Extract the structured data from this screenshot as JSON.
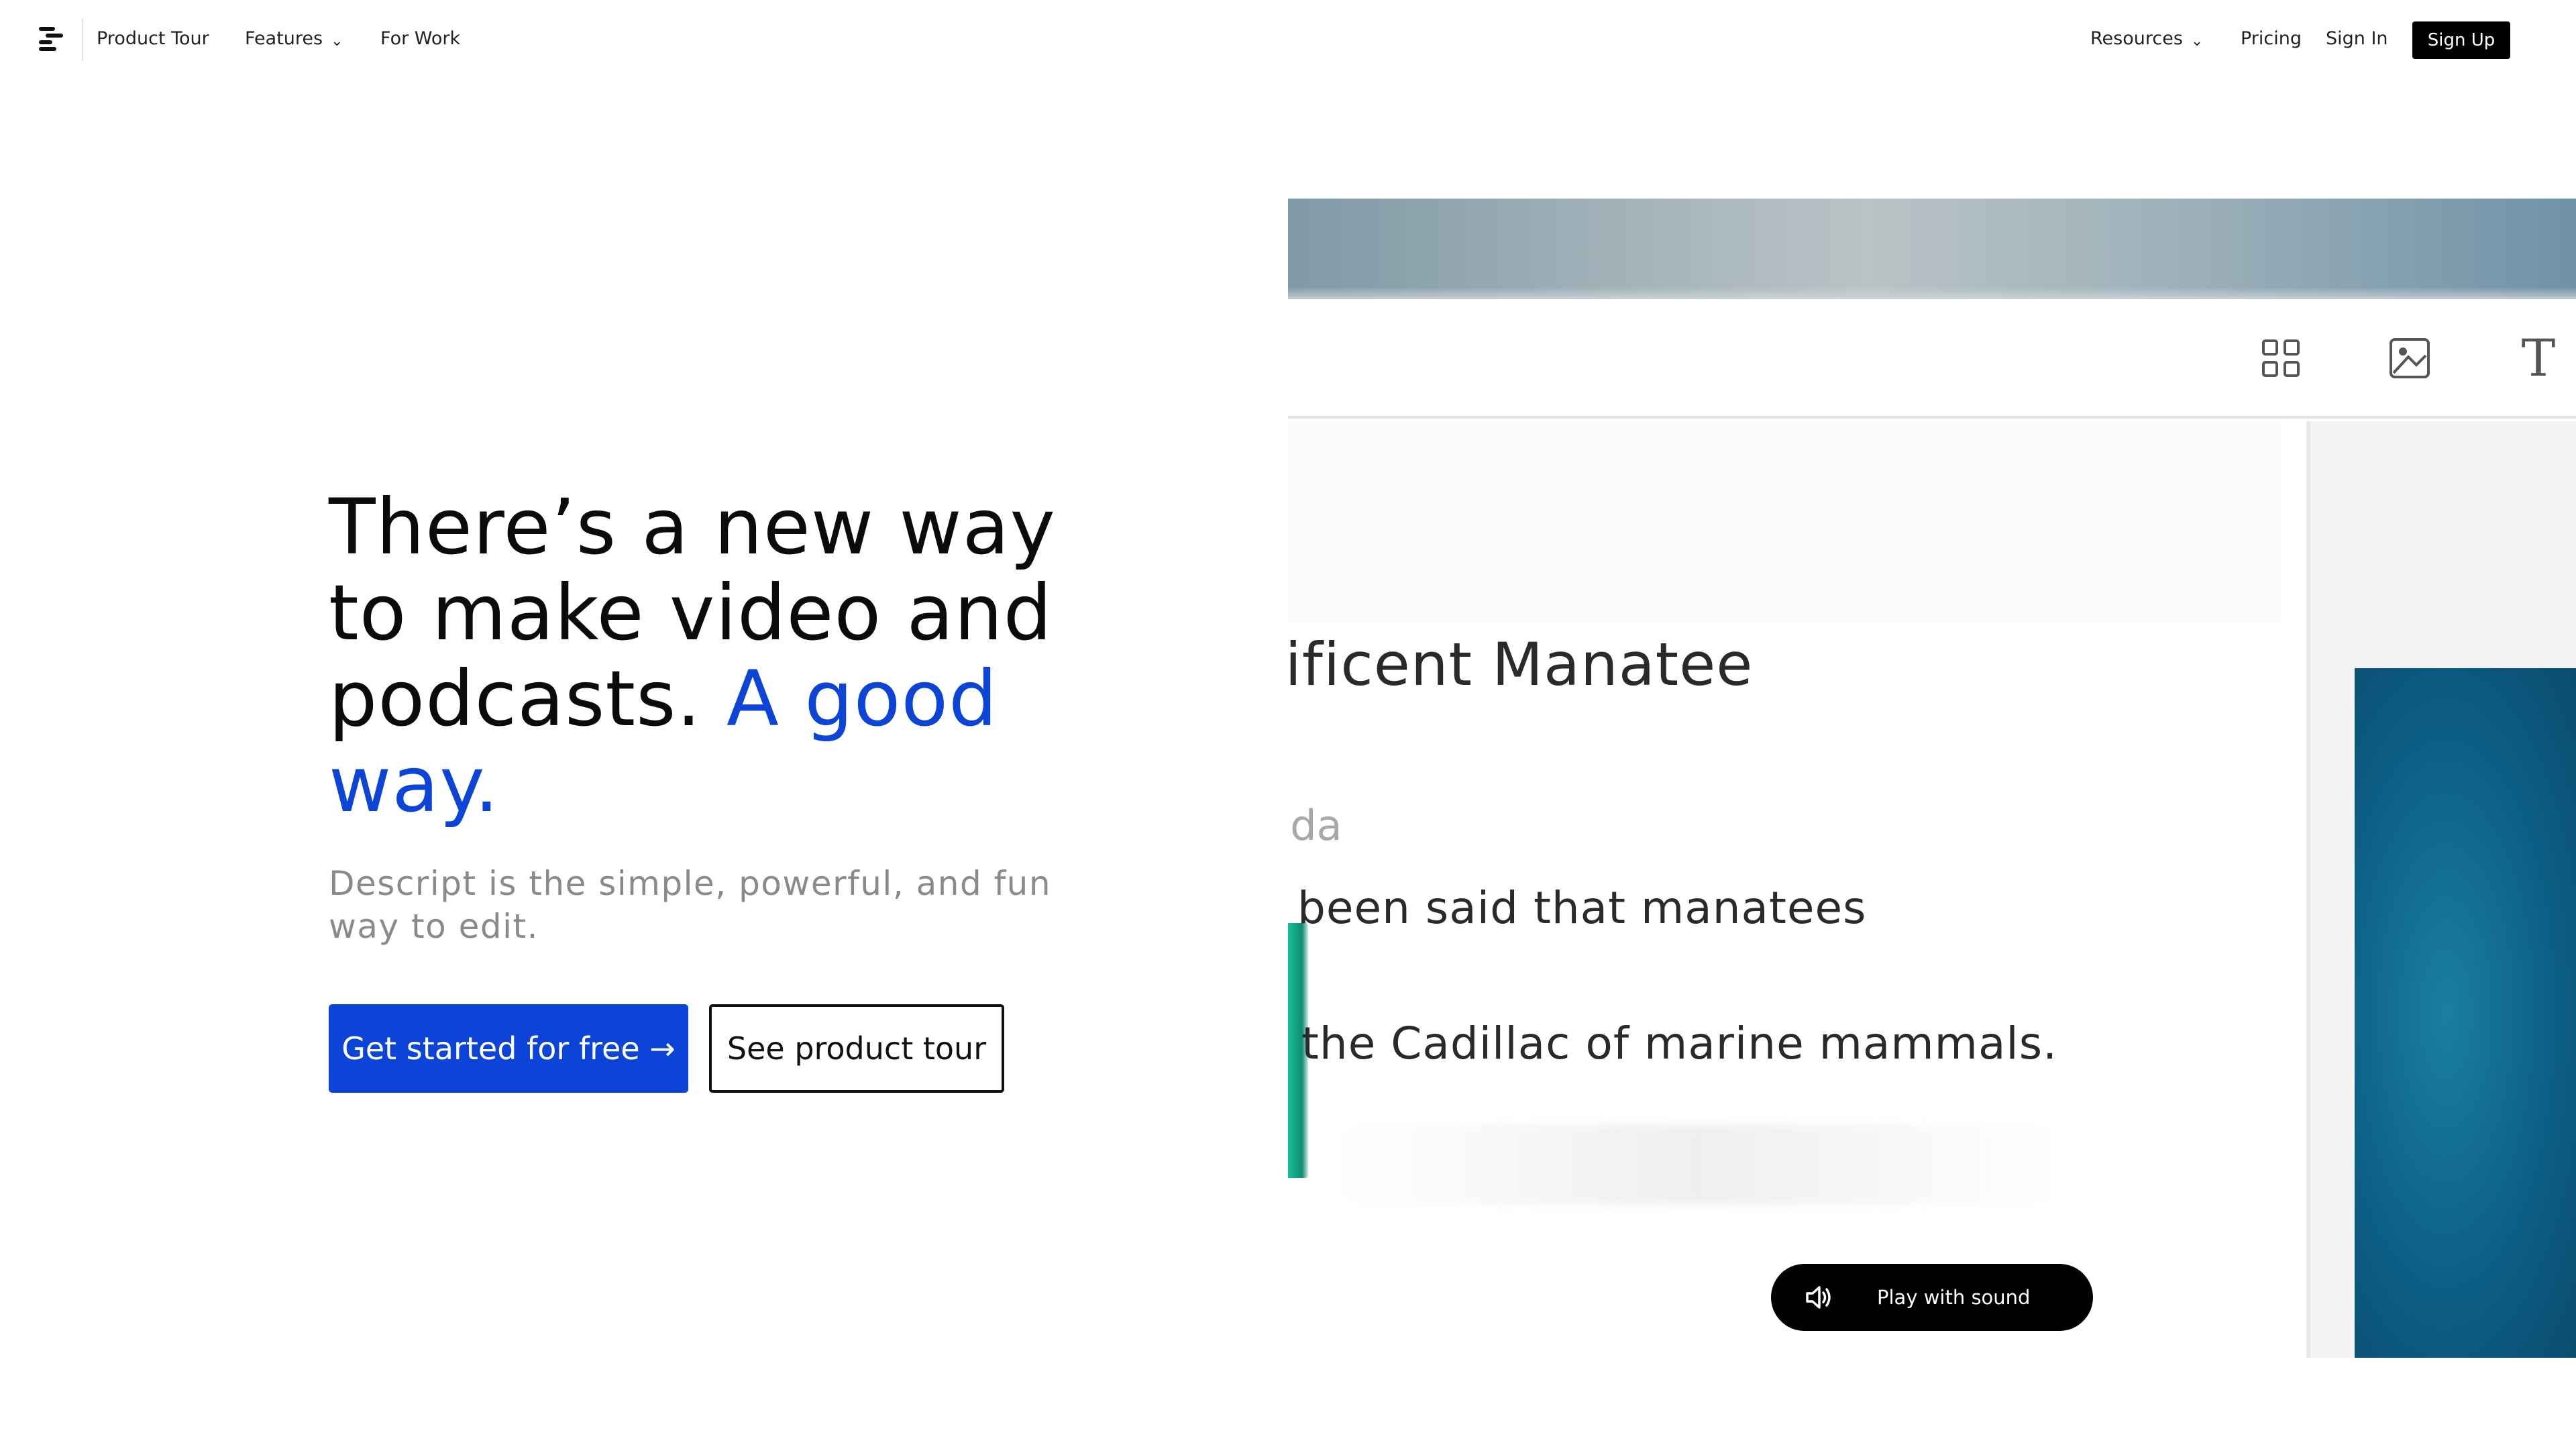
{
  "nav": {
    "logo_icon": "descript-logo-icon",
    "left_links": [
      {
        "label": "Product Tour"
      },
      {
        "label": "Features",
        "has_dropdown": true
      },
      {
        "label": "For Work"
      }
    ],
    "right_links": [
      {
        "label": "Resources",
        "has_dropdown": true
      },
      {
        "label": "Pricing"
      },
      {
        "label": "Sign In"
      }
    ],
    "signup_label": "Sign Up"
  },
  "hero": {
    "headline_main": "There’s a new way to make video and podcasts.",
    "headline_accent": "A good way.",
    "subhead": "Descript is the simple, powerful, and fun way to edit.",
    "primary_cta": "Get started for free →",
    "secondary_cta": "See product tour",
    "accent_color": "#0b44d6"
  },
  "preview": {
    "toolbar_icons": [
      "grid-icon",
      "image-icon",
      "text-icon"
    ],
    "text_tool_glyph": "T",
    "doc_title": "ıificent Manatee",
    "speaker": "ıda",
    "transcript_lines": [
      "been said that manatees",
      "the Cadillac of marine mammals."
    ],
    "play_button_label": "Play with sound",
    "play_icon": "speaker-volume-icon"
  }
}
